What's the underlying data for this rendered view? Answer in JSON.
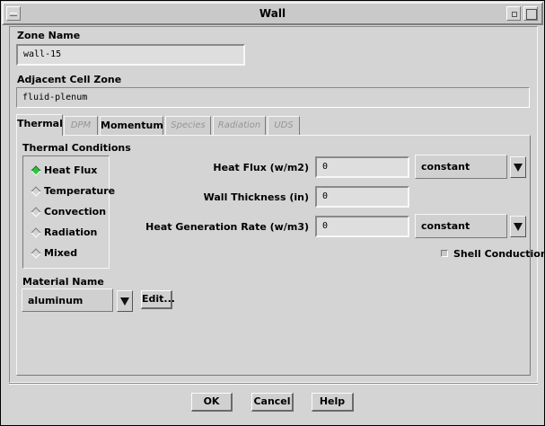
{
  "window": {
    "title": "Wall"
  },
  "zone_name": {
    "label": "Zone Name",
    "value": "wall-15"
  },
  "adjacent_cell_zone": {
    "label": "Adjacent Cell Zone",
    "value": "fluid-plenum"
  },
  "tabs": [
    {
      "label": "Thermal",
      "active": true,
      "enabled": true
    },
    {
      "label": "DPM",
      "active": false,
      "enabled": false
    },
    {
      "label": "Momentum",
      "active": false,
      "enabled": true
    },
    {
      "label": "Species",
      "active": false,
      "enabled": false
    },
    {
      "label": "Radiation",
      "active": false,
      "enabled": false
    },
    {
      "label": "UDS",
      "active": false,
      "enabled": false
    }
  ],
  "thermal": {
    "conditions_label": "Thermal Conditions",
    "options": [
      {
        "label": "Heat Flux",
        "selected": true
      },
      {
        "label": "Temperature",
        "selected": false
      },
      {
        "label": "Convection",
        "selected": false
      },
      {
        "label": "Radiation",
        "selected": false
      },
      {
        "label": "Mixed",
        "selected": false
      }
    ],
    "heat_flux": {
      "label": "Heat Flux (w/m2)",
      "value": "0",
      "method": "constant"
    },
    "wall_thickness": {
      "label": "Wall Thickness (in)",
      "value": "0"
    },
    "heat_generation": {
      "label": "Heat Generation Rate (w/m3)",
      "value": "0",
      "method": "constant"
    },
    "shell_conduction": {
      "label": "Shell Conduction",
      "checked": false
    },
    "material": {
      "label": "Material Name",
      "value": "aluminum",
      "edit_label": "Edit..."
    }
  },
  "buttons": {
    "ok": "OK",
    "cancel": "Cancel",
    "help": "Help"
  },
  "colors": {
    "window_bg": "#d4d4d4",
    "selected_radio": "#2fc43a"
  }
}
